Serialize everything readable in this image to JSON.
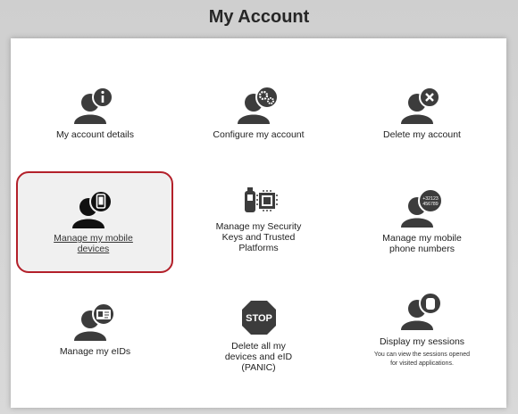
{
  "page": {
    "title": "My Account"
  },
  "tiles": [
    {
      "label": "My account details",
      "icon": "user-info-icon"
    },
    {
      "label": "Configure my account",
      "icon": "user-gear-icon"
    },
    {
      "label": "Delete my account",
      "icon": "user-delete-icon"
    },
    {
      "label": "Manage my mobile devices",
      "icon": "user-mobile-icon",
      "selected": true
    },
    {
      "label": "Manage my Security Keys and Trusted Platforms",
      "icon": "security-key-icon"
    },
    {
      "label": "Manage my mobile phone numbers",
      "icon": "user-phone-number-icon",
      "icon_text": "+32123 456789"
    },
    {
      "label": "Manage my eIDs",
      "icon": "user-eid-card-icon"
    },
    {
      "label": "Delete all my devices and eID (PANIC)",
      "icon": "stop-sign-icon",
      "icon_text": "STOP"
    },
    {
      "label": "Display my sessions",
      "icon": "user-session-icon",
      "sublabel": "You can view the sessions opened for visited applications."
    }
  ],
  "colors": {
    "highlight_border": "#b3202a",
    "icon": "#3c3c3c",
    "background": "#d4d4d4"
  }
}
